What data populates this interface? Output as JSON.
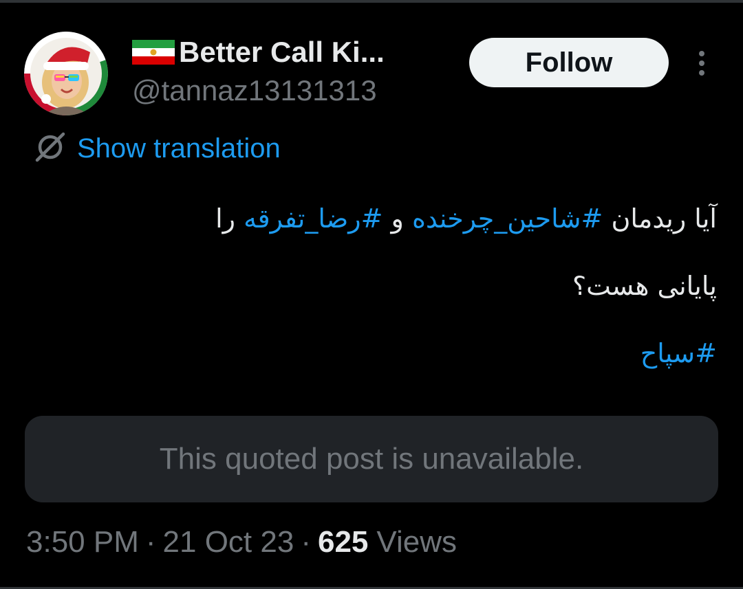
{
  "author": {
    "display_name": "Better Call Ki...",
    "handle": "@tannaz13131313",
    "avatar_description_icon": "avatar-santa-hat-glasses"
  },
  "follow_label": "Follow",
  "translation_label": "Show translation",
  "tweet": {
    "line1": {
      "text_a": "آیا ریدمان ",
      "hashtag_a": "#شاحین_چرخنده",
      "text_b": " و ",
      "hashtag_b": "#رضا_تفرقه",
      "text_c": " را"
    },
    "line2": "پایانی هست؟",
    "line3_hashtag": "#سپاح"
  },
  "quoted_post": "This quoted post is unavailable.",
  "meta": {
    "time": "3:50 PM",
    "separator": "·",
    "date": "21 Oct 23",
    "views_count": "625",
    "views_label": "Views"
  },
  "colors": {
    "background": "#000000",
    "text": "#e7e9ea",
    "muted": "#71767b",
    "link": "#1d9bf0",
    "quoted_bg": "#202327",
    "follow_bg": "#eff3f4"
  }
}
